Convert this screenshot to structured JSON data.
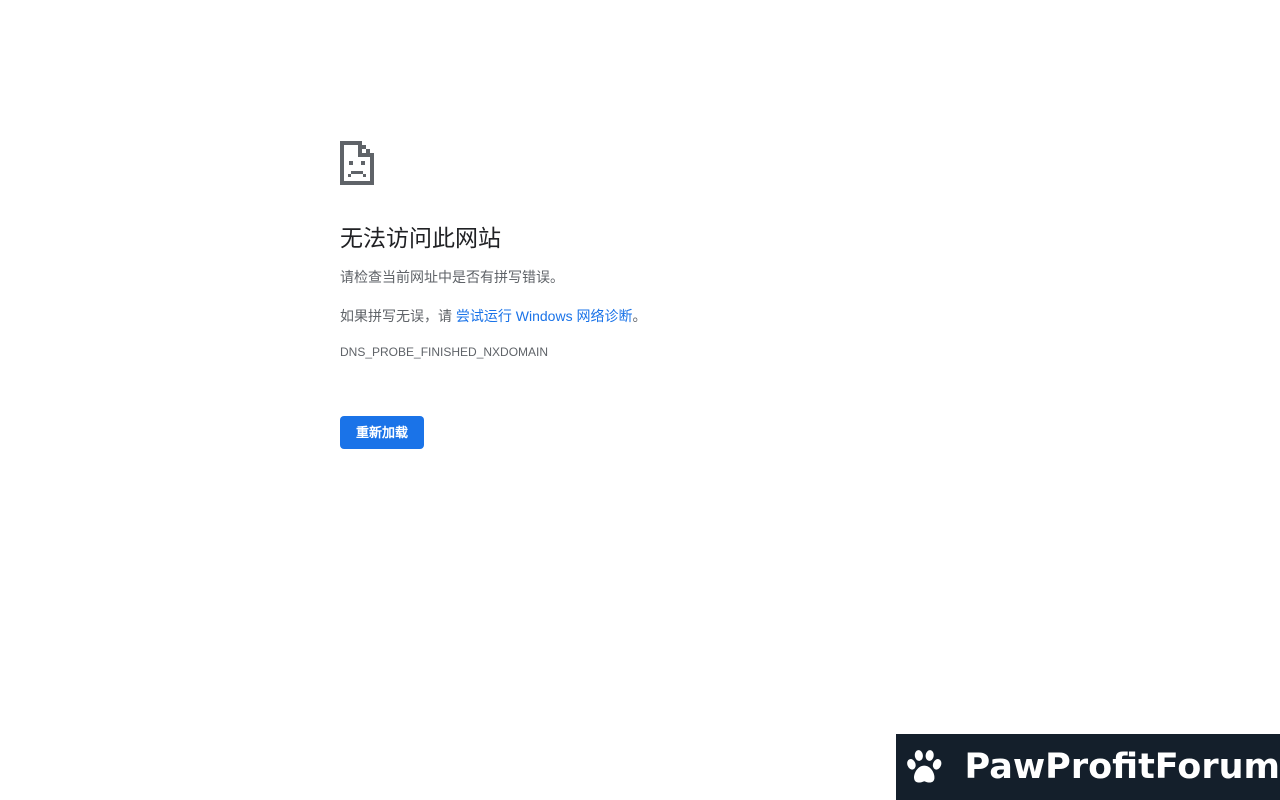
{
  "error_page": {
    "icon": "sad-page-icon",
    "title": "无法访问此网站",
    "message_line1": "请检查当前网址中是否有拼写错误。",
    "message_line2_prefix": "如果拼写无误，请 ",
    "diagnostics_link": "尝试运行 Windows 网络诊断",
    "message_line2_suffix": "。",
    "error_code": "DNS_PROBE_FINISHED_NXDOMAIN",
    "reload_button": "重新加载"
  },
  "watermark": {
    "icon": "paw-icon",
    "brand": "PawProfitForum"
  },
  "colors": {
    "accent": "#1a73e8",
    "title_text": "#202124",
    "body_text": "#5f6368",
    "watermark_bg": "#141f2b"
  }
}
